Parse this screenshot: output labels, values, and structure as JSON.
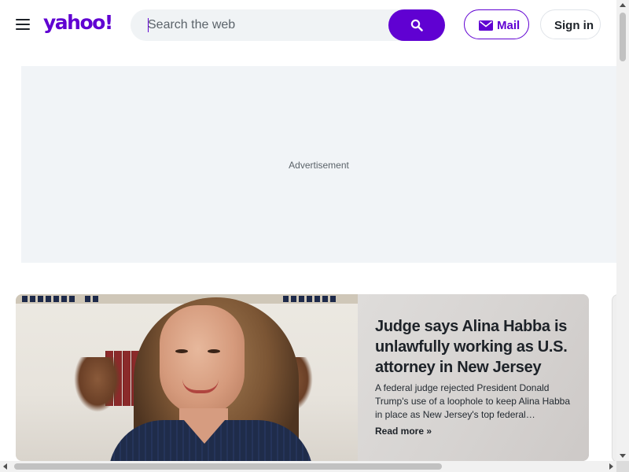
{
  "header": {
    "logo_text": "yahoo!",
    "search": {
      "placeholder": "Search the web",
      "value": ""
    },
    "mail_label": "Mail",
    "signin_label": "Sign in",
    "brand_color": "#6001d2"
  },
  "ad": {
    "label": "Advertisement"
  },
  "story": {
    "headline": "Judge says Alina Habba is unlawfully working as U.S. attorney in New Jersey",
    "summary": "A federal judge rejected President Donald Trump's use of a loophole to keep Alina Habba in place as New Jersey's top federal…",
    "read_more": "Read more »"
  },
  "icons": [
    "menu-icon",
    "search-icon",
    "mail-icon"
  ]
}
